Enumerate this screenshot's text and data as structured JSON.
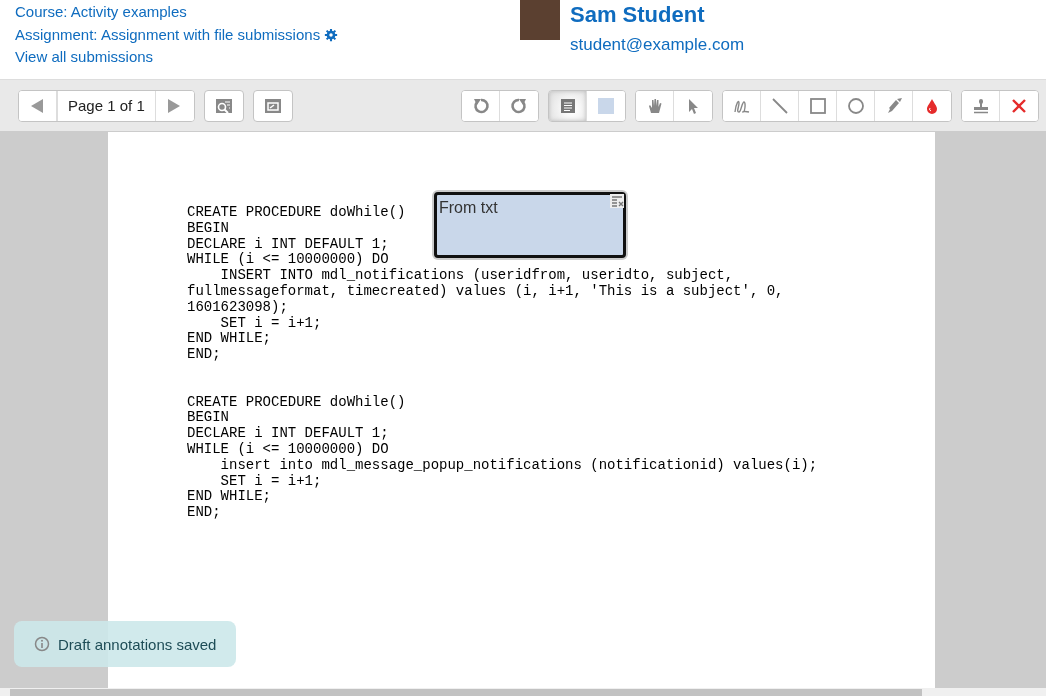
{
  "header": {
    "links": [
      "Course: Activity examples",
      "Assignment: Assignment with file submissions",
      "View all submissions"
    ],
    "user_name": "Sam Student",
    "user_email": "student@example.com"
  },
  "toolbar": {
    "page_label": "Page 1 of 1",
    "tools": [
      {
        "selected": true
      },
      {
        "selected": false
      },
      {
        "selected": false
      },
      {
        "selected": false
      },
      {
        "selected": false
      },
      {
        "selected": false
      },
      {
        "selected": false
      },
      {
        "selected": false
      },
      {
        "selected": false
      }
    ]
  },
  "document": {
    "code_blocks": [
      [
        "CREATE PROCEDURE doWhile()",
        "BEGIN",
        "DECLARE i INT DEFAULT 1;",
        "WHILE (i <= 10000000) DO",
        "    INSERT INTO mdl_notifications (useridfrom, useridto, subject,",
        "fullmessageformat, timecreated) values (i, i+1, 'This is a subject', 0,",
        "1601623098);",
        "    SET i = i+1;",
        "END WHILE;",
        "END;"
      ],
      [
        "CREATE PROCEDURE doWhile()",
        "BEGIN",
        "DECLARE i INT DEFAULT 1;",
        "WHILE (i <= 10000000) DO",
        "    insert into mdl_message_popup_notifications (notificationid) values(i);",
        "    SET i = i+1;",
        "END WHILE;",
        "END;"
      ]
    ],
    "comment": {
      "text": "From txt",
      "color": "#c9d7ea"
    }
  },
  "toast": "Draft annotations saved"
}
